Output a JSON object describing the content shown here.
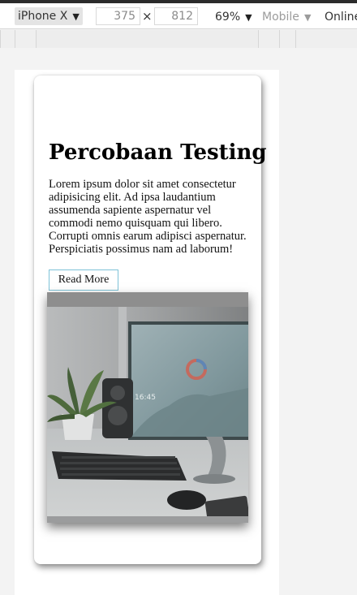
{
  "toolbar": {
    "device": "iPhone X",
    "width": "375",
    "height": "812",
    "times": "×",
    "zoom": "69%",
    "mode": "Mobile",
    "network": "Online"
  },
  "card": {
    "title": "Percobaan Testing",
    "body": "Lorem ipsum dolor sit amet consectetur adipisicing elit. Ad ipsa laudantium assumenda sapiente aspernatur vel commodi nemo quisquam qui libero. Corrupti omnis earum adipisci aspernatur. Perspiciatis possimus nam ad laborum!",
    "button_label": "Read More"
  },
  "photo": {
    "screen_time": "16:45"
  },
  "colors": {
    "button_border": "#7ec3d8",
    "toolbar_bg": "#ffffff",
    "page_bg": "#f3f3f3"
  }
}
